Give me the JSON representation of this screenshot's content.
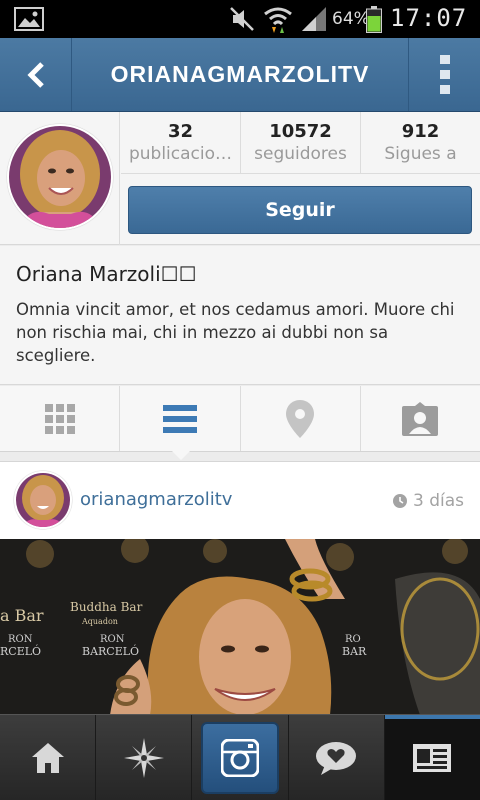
{
  "status_bar": {
    "battery_percent": "64%",
    "time": "17:07",
    "icons": [
      "gallery-icon",
      "mute-icon",
      "wifi-icon",
      "signal-icon",
      "battery-icon"
    ]
  },
  "header": {
    "title": "ORIANAGMARZOLITV",
    "back_icon": "chevron-left-icon",
    "menu_icon": "overflow-menu-icon"
  },
  "profile": {
    "stats": [
      {
        "value": "32",
        "label": "publicacio…"
      },
      {
        "value": "10572",
        "label": "seguidores"
      },
      {
        "value": "912",
        "label": "Sigues a"
      }
    ],
    "follow_label": "Seguir"
  },
  "bio": {
    "name": "Oriana Marzoli☐☐",
    "text": "Omnia vincit amor, et nos cedamus amori. Muore chi non rischia mai, chi in mezzo ai dubbi non sa scegliere."
  },
  "view_tabs": [
    {
      "icon": "grid-icon"
    },
    {
      "icon": "list-icon",
      "active": true
    },
    {
      "icon": "location-pin-icon"
    },
    {
      "icon": "tagged-photos-icon"
    }
  ],
  "post": {
    "username": "orianagmarzolitv",
    "time": "3 días",
    "clock_icon": "clock-icon",
    "photo_text": {
      "brand_left": "a Bar",
      "brand_center_1": "Buddha Bar",
      "brand_center_2": "Aquadon",
      "sponsor_left_1": "RON",
      "sponsor_left_2": "RCELÓ",
      "sponsor_center_1": "RON",
      "sponsor_center_2": "BARCELÓ",
      "sponsor_right_1": "RO",
      "sponsor_right_2": "BAR"
    }
  },
  "bottom_nav": [
    {
      "icon": "home-icon"
    },
    {
      "icon": "explore-icon"
    },
    {
      "icon": "camera-icon"
    },
    {
      "icon": "activity-icon"
    },
    {
      "icon": "profile-icon",
      "active": true
    }
  ],
  "colors": {
    "accent": "#3f6f99",
    "titlebar": "#3f6d97",
    "follow_button": "#4573a0"
  }
}
